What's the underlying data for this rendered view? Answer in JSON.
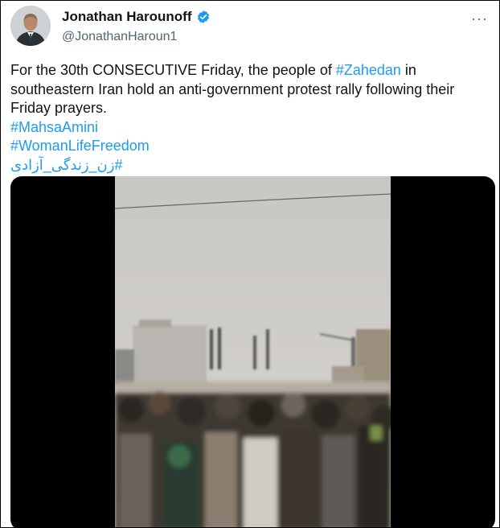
{
  "author": {
    "display_name": "Jonathan Harounoff",
    "handle": "@JonathanHaroun1",
    "verified": true,
    "avatar_icon": "profile-photo",
    "verified_color": "#1d9bf0"
  },
  "menu": {
    "more_label": "···"
  },
  "tweet": {
    "line1_a": "For the 30th CONSECUTIVE Friday, the people of ",
    "line1_tag": "#Zahedan",
    "line1_b": " in",
    "line2": "southeastern Iran hold an anti-government protest rally following their",
    "line3": "Friday prayers.",
    "hashtag1": "#MahsaAmini",
    "hashtag2": "#WomanLifeFreedom",
    "hashtag3": "#زن_زندگی_آزادی"
  },
  "media": {
    "type": "video",
    "description_icon": "video-thumbnail"
  },
  "colors": {
    "link": "#1d9bf0",
    "text": "#0f1419",
    "muted": "#536471"
  }
}
